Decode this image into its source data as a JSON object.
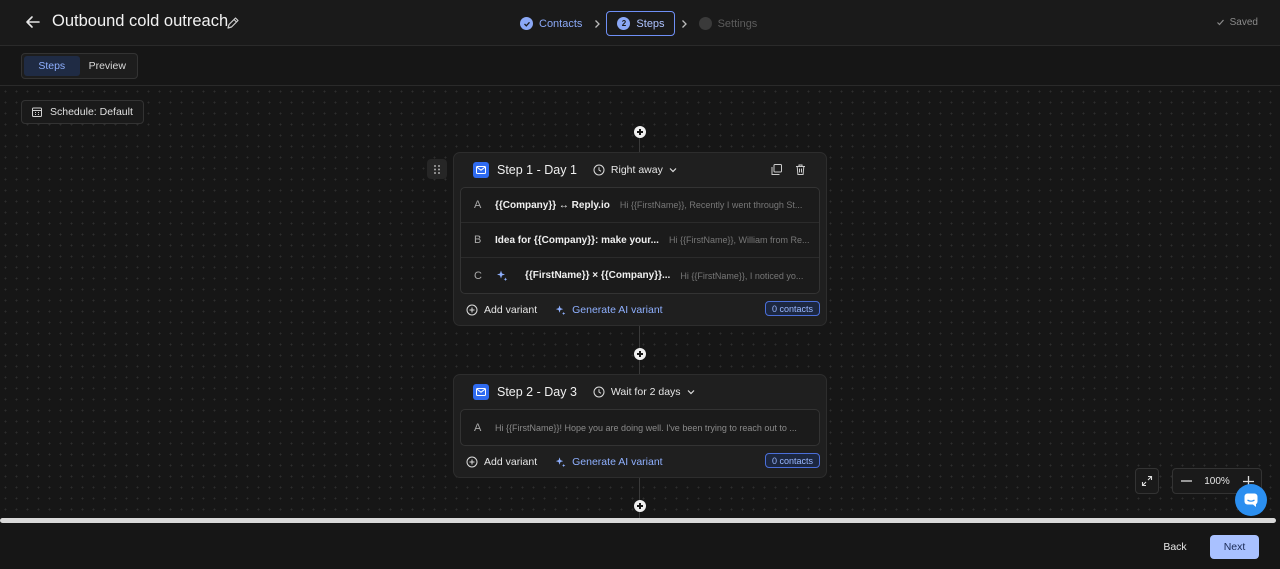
{
  "header": {
    "title": "Outbound cold outreach",
    "saved_label": "Saved",
    "stepper": [
      {
        "num": "1",
        "label": "Contacts",
        "state": "done"
      },
      {
        "num": "2",
        "label": "Steps",
        "state": "active"
      },
      {
        "num": "3",
        "label": "Settings",
        "state": "pending"
      }
    ]
  },
  "view_toggle": {
    "steps": "Steps",
    "preview": "Preview",
    "selected": "Steps"
  },
  "schedule": {
    "label": "Schedule: Default"
  },
  "steps": [
    {
      "title": "Step 1 - Day 1",
      "timing": "Right away",
      "variants": [
        {
          "letter": "A",
          "subject": "{{Company}} ↔ Reply.io",
          "preview": "Hi {{FirstName}}, Recently I went through St...",
          "ai": false
        },
        {
          "letter": "B",
          "subject": "Idea for {{Company}}: make your...",
          "preview": "Hi {{FirstName}}, William from Re...",
          "ai": false
        },
        {
          "letter": "C",
          "subject": "{{FirstName}} × {{Company}}...",
          "preview": "Hi {{FirstName}}, I noticed yo...",
          "ai": true
        }
      ],
      "add_variant": "Add variant",
      "generate_ai": "Generate AI variant",
      "contacts": "0 contacts"
    },
    {
      "title": "Step 2 - Day 3",
      "timing": "Wait for 2 days",
      "variants": [
        {
          "letter": "A",
          "subject": "",
          "preview": "Hi {{FirstName}}! Hope you are doing well. I've been trying to reach out to ...",
          "ai": false
        }
      ],
      "add_variant": "Add variant",
      "generate_ai": "Generate AI variant",
      "contacts": "0 contacts"
    }
  ],
  "zoom": {
    "value": "100%"
  },
  "footer": {
    "back": "Back",
    "next": "Next"
  },
  "colors": {
    "accent": "#8ba8f6",
    "mail_icon": "#2f6bf0",
    "chat_bubble": "#2b8ff0",
    "next_button": "#a9c1ff"
  }
}
